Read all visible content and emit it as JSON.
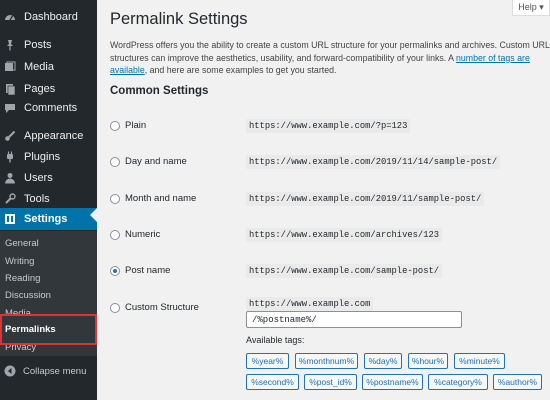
{
  "sidebar": {
    "items": [
      {
        "label": "Dashboard",
        "icon": "dashboard-icon"
      },
      {
        "label": "Posts",
        "icon": "pin-icon"
      },
      {
        "label": "Media",
        "icon": "media-icon"
      },
      {
        "label": "Pages",
        "icon": "pages-icon"
      },
      {
        "label": "Comments",
        "icon": "comment-icon"
      },
      {
        "label": "Appearance",
        "icon": "brush-icon"
      },
      {
        "label": "Plugins",
        "icon": "plug-icon"
      },
      {
        "label": "Users",
        "icon": "user-icon"
      },
      {
        "label": "Tools",
        "icon": "wrench-icon"
      },
      {
        "label": "Settings",
        "icon": "settings-icon"
      }
    ],
    "submenu": [
      "General",
      "Writing",
      "Reading",
      "Discussion",
      "Media",
      "Permalinks",
      "Privacy"
    ],
    "collapse_label": "Collapse menu",
    "accent_color": "#0073aa",
    "highlight_color": "#d63638"
  },
  "help_label": "Help ▾",
  "page_title": "Permalink Settings",
  "intro": {
    "text": "WordPress offers you the ability to create a custom URL structure for your permalinks and archives. Custom URL structures can improve the aesthetics, usability, and forward-compatibility of your links. A ",
    "link": "number of tags are available",
    "text_after": ", and here are some examples to get you started."
  },
  "section_title": "Common Settings",
  "options": [
    {
      "label": "Plain",
      "example": "https://www.example.com/?p=123",
      "checked": false
    },
    {
      "label": "Day and name",
      "example": "https://www.example.com/2019/11/14/sample-post/",
      "checked": false
    },
    {
      "label": "Month and name",
      "example": "https://www.example.com/2019/11/sample-post/",
      "checked": false
    },
    {
      "label": "Numeric",
      "example": "https://www.example.com/archives/123",
      "checked": false
    },
    {
      "label": "Post name",
      "example": "https://www.example.com/sample-post/",
      "checked": true
    },
    {
      "label": "Custom Structure",
      "example": "https://www.example.com",
      "checked": false
    }
  ],
  "custom_structure_value": "/%postname%/",
  "available_tags_label": "Available tags:",
  "tags": [
    "%year%",
    "%monthnum%",
    "%day%",
    "%hour%",
    "%minute%",
    "%second%",
    "%post_id%",
    "%postname%",
    "%category%",
    "%author%"
  ]
}
